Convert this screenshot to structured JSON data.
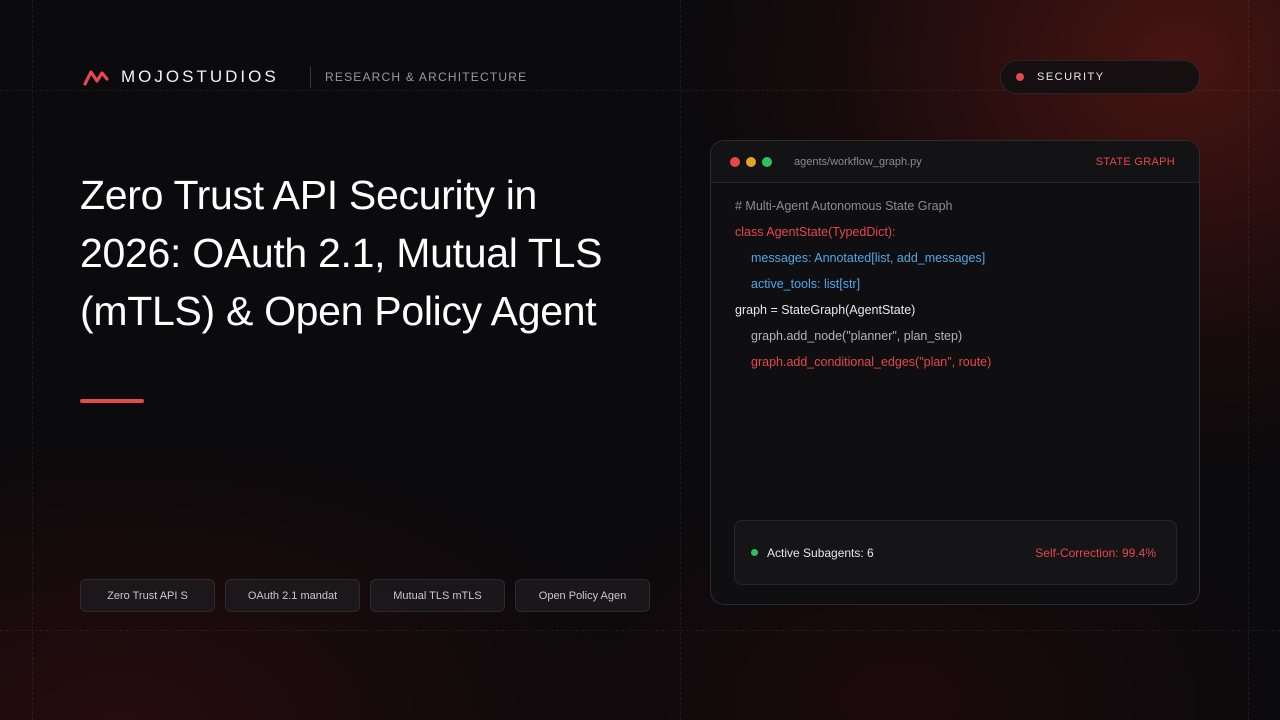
{
  "brand": {
    "name": "MOJOSTUDIOS",
    "subtitle": "RESEARCH & ARCHITECTURE",
    "accent_color": "#e5484d"
  },
  "category_pill": {
    "label": "SECURITY",
    "dot_color": "#e5484d"
  },
  "hero": {
    "title_lines": [
      "Zero Trust API Security in",
      "2026: OAuth 2.1, Mutual TLS",
      "(mTLS) & Open Policy Agent"
    ]
  },
  "tags": [
    "Zero Trust API S",
    "OAuth 2.1 mandat",
    "Mutual TLS mTLS",
    "Open Policy Agen"
  ],
  "code_window": {
    "filename": "agents/workflow_graph.py",
    "badge": "STATE GRAPH",
    "window_dots": [
      "#e5484d",
      "#e0a526",
      "#2fbf5b"
    ],
    "lines": [
      {
        "text": "# Multi-Agent Autonomous State Graph",
        "style": "comment",
        "indent": false
      },
      {
        "text": "class AgentState(TypedDict):",
        "style": "red",
        "indent": false
      },
      {
        "text": "messages: Annotated[list, add_messages]",
        "style": "blue",
        "indent": true
      },
      {
        "text": "active_tools: list[str]",
        "style": "blue",
        "indent": true
      },
      {
        "text": "graph = StateGraph(AgentState)",
        "style": "white",
        "indent": false
      },
      {
        "text": "graph.add_node(\"planner\", plan_step)",
        "style": "grey",
        "indent": true
      },
      {
        "text": "graph.add_conditional_edges(\"plan\", route)",
        "style": "red",
        "indent": true
      }
    ],
    "status": {
      "left": "Active Subagents: 6",
      "right": "Self-Correction: 99.4%",
      "dot_color": "#2fbf5b"
    }
  }
}
